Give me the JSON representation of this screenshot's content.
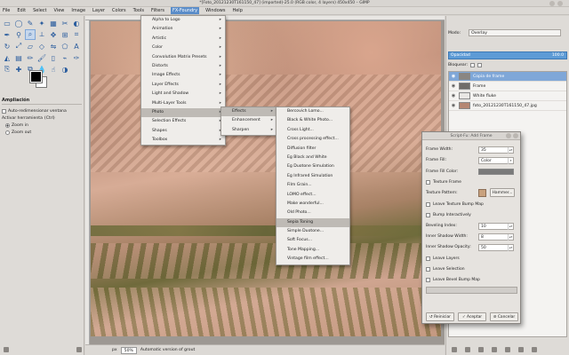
{
  "window": {
    "title": "*[Foto_20121230T161150_47] (imported)-25.0 (RGB color, 4 layers) 450x450 – GIMP"
  },
  "menubar": [
    "File",
    "Edit",
    "Select",
    "View",
    "Image",
    "Layer",
    "Colors",
    "Tools",
    "Filters",
    "FX-Foundry",
    "Windows",
    "Help"
  ],
  "toolbox": {
    "tool_options_title": "Ampliación",
    "auto_resize_label": "Auto-redimensionar ventana",
    "activate_label": "Activar herramienta",
    "activate_shortcut": "(Ctrl)",
    "zoom_in": "Zoom in",
    "zoom_out": "Zoom out"
  },
  "menus": {
    "fx_foundry": [
      "Alpha to Logo",
      "Animation",
      "Artistic",
      "Color",
      "Convolution Matrix Presets",
      "Distorts",
      "Image Effects",
      "Layer Effects",
      "Light and Shadow",
      "Multi-Layer Tools",
      "Photo",
      "Selection Effects",
      "Shapes",
      "Toolbox"
    ],
    "photo": [
      "Effects",
      "Enhancement",
      "Sharpen"
    ],
    "effects": [
      "Bercovich Lomo...",
      "Black & White Photo...",
      "Cross Light...",
      "Cross processing effect...",
      "Diffusion filter",
      "Eg Black and White",
      "Eg Duotone Simulation",
      "Eg Infrared Simulation",
      "Film Grain...",
      "LOMO effect...",
      "Make wonderful...",
      "Old Photo...",
      "Sepia Toning",
      "Simple Duotone...",
      "Soft Focus...",
      "Tone Mapping...",
      "Vintage film effect..."
    ]
  },
  "dock": {
    "mode_label": "Modo:",
    "mode_value": "Overlay",
    "opacity_label": "Opacidad",
    "opacity_value": "100.0",
    "lock_label": "Bloquear:",
    "layers": [
      {
        "name": "Copia de frame",
        "thumb": "#8a8682",
        "selected": true
      },
      {
        "name": "Frame",
        "thumb": "#6f6c69",
        "selected": false
      },
      {
        "name": "White fluke",
        "thumb": "#e9e7e4",
        "selected": false
      },
      {
        "name": "foto_20121230T161150_47.jpg",
        "thumb": "#b58773",
        "selected": false
      }
    ]
  },
  "dialog": {
    "title": "Script-Fu: Add Frame",
    "frame_width_label": "Frame Width:",
    "frame_width": "35",
    "frame_fill_label": "Frame Fill:",
    "frame_fill": "Color",
    "frame_fill_color_label": "Frame Fill Color:",
    "texture_frame_label": "Texture Frame",
    "texture_pattern_label": "Texture Pattern:",
    "texture_pattern": "Hammer...",
    "leave_texture_bump_label": "Leave Texture Bump Map",
    "bump_interactively_label": "Bump Interactively",
    "beveling_index_label": "Beveling Index:",
    "beveling_index": "10",
    "inner_shadow_width_label": "Inner Shadow Width:",
    "inner_shadow_width": "8",
    "inner_shadow_opacity_label": "Inner Shadow Opacity:",
    "inner_shadow_opacity": "50",
    "leave_layers_label": "Leave Layers",
    "leave_selection_label": "Leave Selection",
    "leave_bevel_bump_label": "Leave Bevel Bump Map",
    "reset_label": "Reiniciar",
    "ok_label": "Aceptar",
    "cancel_label": "Cancelar"
  },
  "statusbar": {
    "unit": "px",
    "zoom": "50%",
    "message": "Automatic version of grout"
  },
  "colors": {
    "accent": "#5b8dc9",
    "selection": "#7fa7d8",
    "foreground": "#000000",
    "background": "#ffffff"
  }
}
